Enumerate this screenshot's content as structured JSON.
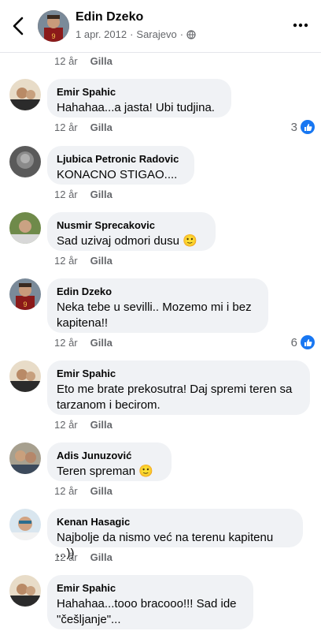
{
  "header": {
    "name": "Edin Dzeko",
    "date": "1 apr. 2012",
    "separator": "·",
    "location": "Sarajevo",
    "separator2": "·"
  },
  "top_meta": {
    "time": "12 år",
    "like": "Gilla"
  },
  "comments": [
    {
      "author": "Emir Spahic",
      "lines": [
        "Hahahaa...a jasta! Ubi tudjina."
      ],
      "time": "12 år",
      "like": "Gilla",
      "reactions": "3"
    },
    {
      "author": "Ljubica Petronic Radovic",
      "lines": [
        "KONACNO STIGAO...."
      ],
      "time": "12 år",
      "like": "Gilla"
    },
    {
      "author": "Nusmir Sprecakovic",
      "lines": [
        "Sad uzivaj odmori dusu 🙂"
      ],
      "time": "12 år",
      "like": "Gilla"
    },
    {
      "author": "Edin Dzeko",
      "lines": [
        "Neka tebe u sevilli.. Mozemo mi i bez",
        "kapitena!!"
      ],
      "time": "12 år",
      "like": "Gilla",
      "reactions": "6"
    },
    {
      "author": "Emir Spahic",
      "lines": [
        "Eto me brate prekosutra! Daj spremi teren sa",
        "tarzanom i becirom."
      ],
      "time": "12 år",
      "like": "Gilla"
    },
    {
      "author": "Adis Junuzović",
      "lines": [
        "Teren spreman 🙂"
      ],
      "time": "12 år",
      "like": "Gilla"
    },
    {
      "author": "Kenan Hasagic",
      "lines": [
        "Najbolje da nismo već na terenu kapitenu ...))"
      ],
      "time": "12 år",
      "like": "Gilla"
    },
    {
      "author": "Emir Spahic",
      "lines": [
        "Hahahaa...tooo bracooo!!! Sad ide",
        "\"češljanje\"..."
      ]
    }
  ],
  "icons": {
    "back": "chevron-left-icon",
    "more": "more-horizontal-icon",
    "privacy": "globe-icon",
    "reaction": "like-thumb-icon"
  },
  "colors": {
    "bubble": "#f0f2f5",
    "meta": "#65676b",
    "like_blue": "#1877f2"
  }
}
